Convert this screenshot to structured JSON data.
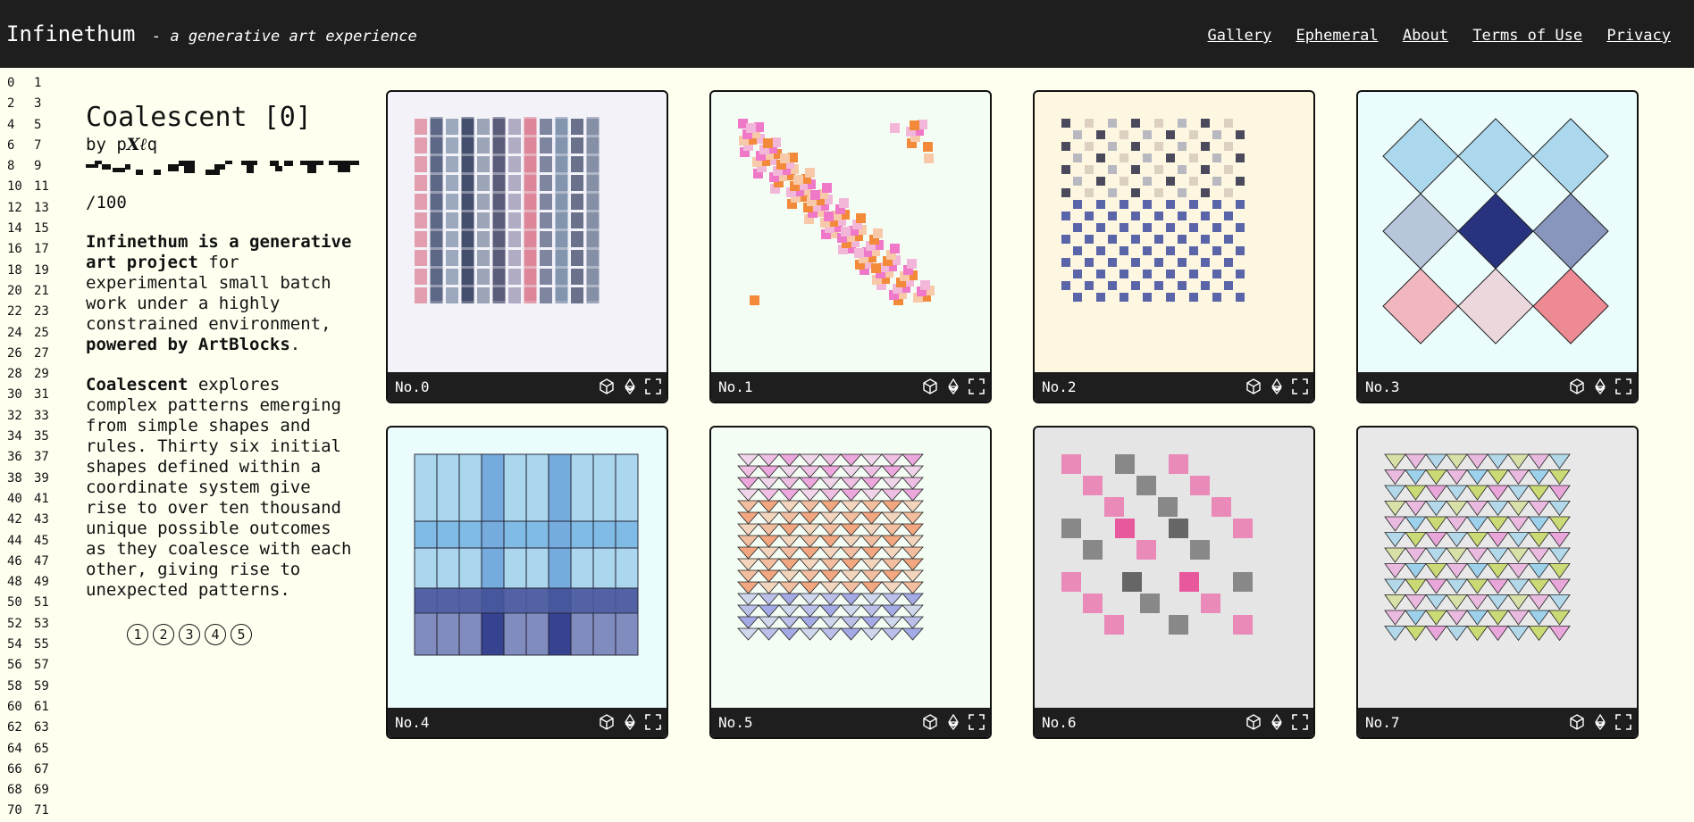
{
  "header": {
    "brand": "Infinethum",
    "tagline": "- a generative art experience",
    "nav": [
      "Gallery",
      "Ephemeral",
      "About",
      "Terms of Use",
      "Privacy"
    ]
  },
  "index_numbers": [
    [
      "0",
      "1"
    ],
    [
      "2",
      "3"
    ],
    [
      "4",
      "5"
    ],
    [
      "6",
      "7"
    ],
    [
      "8",
      "9"
    ],
    [
      "10",
      "11"
    ],
    [
      "12",
      "13"
    ],
    [
      "14",
      "15"
    ],
    [
      "16",
      "17"
    ],
    [
      "18",
      "19"
    ],
    [
      "20",
      "21"
    ],
    [
      "22",
      "23"
    ],
    [
      "24",
      "25"
    ],
    [
      "26",
      "27"
    ],
    [
      "28",
      "29"
    ],
    [
      "30",
      "31"
    ],
    [
      "32",
      "33"
    ],
    [
      "34",
      "35"
    ],
    [
      "36",
      "37"
    ],
    [
      "38",
      "39"
    ],
    [
      "40",
      "41"
    ],
    [
      "42",
      "43"
    ],
    [
      "44",
      "45"
    ],
    [
      "46",
      "47"
    ],
    [
      "48",
      "49"
    ],
    [
      "50",
      "51"
    ],
    [
      "52",
      "53"
    ],
    [
      "54",
      "55"
    ],
    [
      "56",
      "57"
    ],
    [
      "58",
      "59"
    ],
    [
      "60",
      "61"
    ],
    [
      "62",
      "63"
    ],
    [
      "64",
      "65"
    ],
    [
      "66",
      "67"
    ],
    [
      "68",
      "69"
    ],
    [
      "70",
      "71"
    ]
  ],
  "info": {
    "title": "Coalescent [0]",
    "by": "by",
    "artist_pre": "p",
    "artist_bold": "Xℓ",
    "artist_post": "q",
    "edition": "/100",
    "intro_bold1": "Infinethum is a generative art project",
    "intro_rest": "for experimental small batch work under a highly constrained environment,",
    "intro_bold2": "powered by ArtBlocks",
    "intro_end": ".",
    "desc_bold": "Coalescent",
    "desc_rest": "explores complex patterns emerging from simple shapes and rules. Thirty six initial shapes defined within a coordinate system give rise to over ten thousand unique possible outcomes as they coalesce with each other, giving rise to unexpected patterns.",
    "pages": [
      "1",
      "2",
      "3",
      "4",
      "5"
    ]
  },
  "cards": [
    {
      "label": "No.0",
      "bg": "#f2f2f8"
    },
    {
      "label": "No.1",
      "bg": "#f4fdf4"
    },
    {
      "label": "No.2",
      "bg": "#fdf6e0"
    },
    {
      "label": "No.3",
      "bg": "#ebfcfc"
    },
    {
      "label": "No.4",
      "bg": "#ebfcfc"
    },
    {
      "label": "No.5",
      "bg": "#f4fdf4"
    },
    {
      "label": "No.6",
      "bg": "#e5e5e5"
    },
    {
      "label": "No.7",
      "bg": "#e8e8e8"
    }
  ],
  "icons": [
    "cube-icon",
    "ethereum-icon",
    "fullscreen-icon"
  ]
}
